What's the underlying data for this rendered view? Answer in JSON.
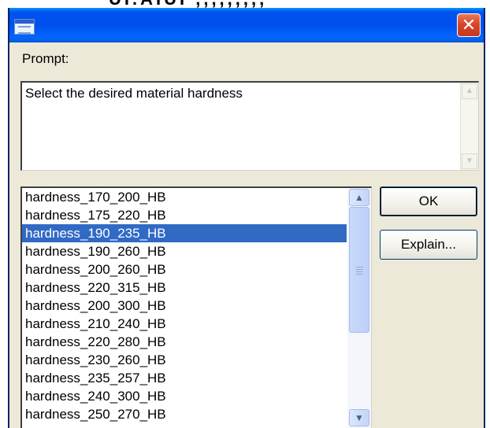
{
  "top_strip": {
    "cropped_text": "UI.AIUI  ,,,,,,,,,"
  },
  "window": {
    "title": "",
    "icon": "application-icon",
    "close_icon": "close-icon",
    "close_glyph": "✕"
  },
  "prompt": {
    "label": "Prompt:",
    "text": "Select the desired material hardness",
    "scroll_up_glyph": "▲",
    "scroll_down_glyph": "▼"
  },
  "list": {
    "selected": "hardness_190_235_HB",
    "items": [
      "hardness_170_200_HB",
      "hardness_175_220_HB",
      "hardness_190_235_HB",
      "hardness_190_260_HB",
      "hardness_200_260_HB",
      "hardness_220_315_HB",
      "hardness_200_300_HB",
      "hardness_210_240_HB",
      "hardness_220_280_HB",
      "hardness_230_260_HB",
      "hardness_235_257_HB",
      "hardness_240_300_HB",
      "hardness_250_270_HB"
    ],
    "scroll_up_glyph": "▲",
    "scroll_down_glyph": "▼"
  },
  "buttons": {
    "ok": "OK",
    "explain": "Explain..."
  },
  "colors": {
    "titlebar": "#0053ee",
    "selection": "#316ac5",
    "dialog_bg": "#ece9d8",
    "close_button": "#d9452a"
  }
}
